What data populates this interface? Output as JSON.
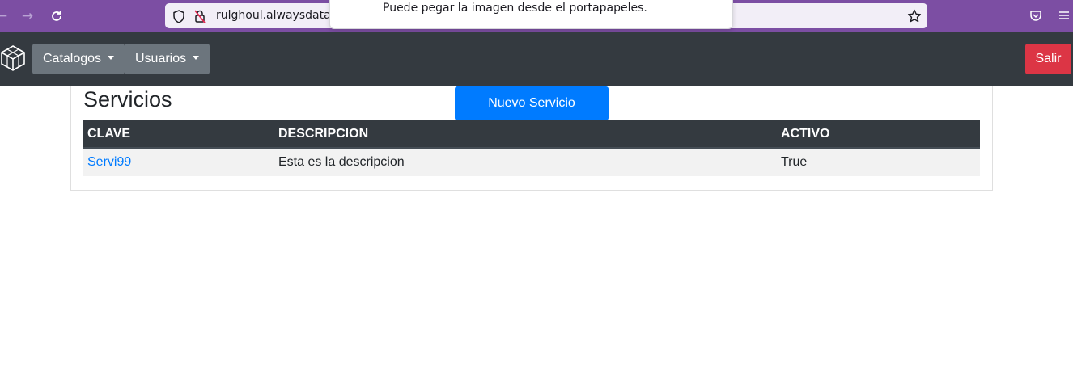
{
  "browser": {
    "url": "rulghoul.alwaysdata",
    "toast_message": "Puede pegar la imagen desde el portapapeles."
  },
  "navbar": {
    "menus": [
      "Catalogos",
      "Usuarios"
    ],
    "logout_label": "Salir"
  },
  "page": {
    "title": "Servicios",
    "new_button_label": "Nuevo Servicio"
  },
  "table": {
    "headers": [
      "CLAVE",
      "DESCRIPCION",
      "ACTIVO"
    ],
    "rows": [
      {
        "clave": "Servi99",
        "descripcion": "Esta es la descripcion",
        "activo": "True"
      }
    ]
  },
  "colors": {
    "browser_chrome": "#7c4ea3",
    "navbar": "#343a40",
    "primary": "#007bff",
    "danger": "#dc3545",
    "secondary": "#6c757d"
  }
}
